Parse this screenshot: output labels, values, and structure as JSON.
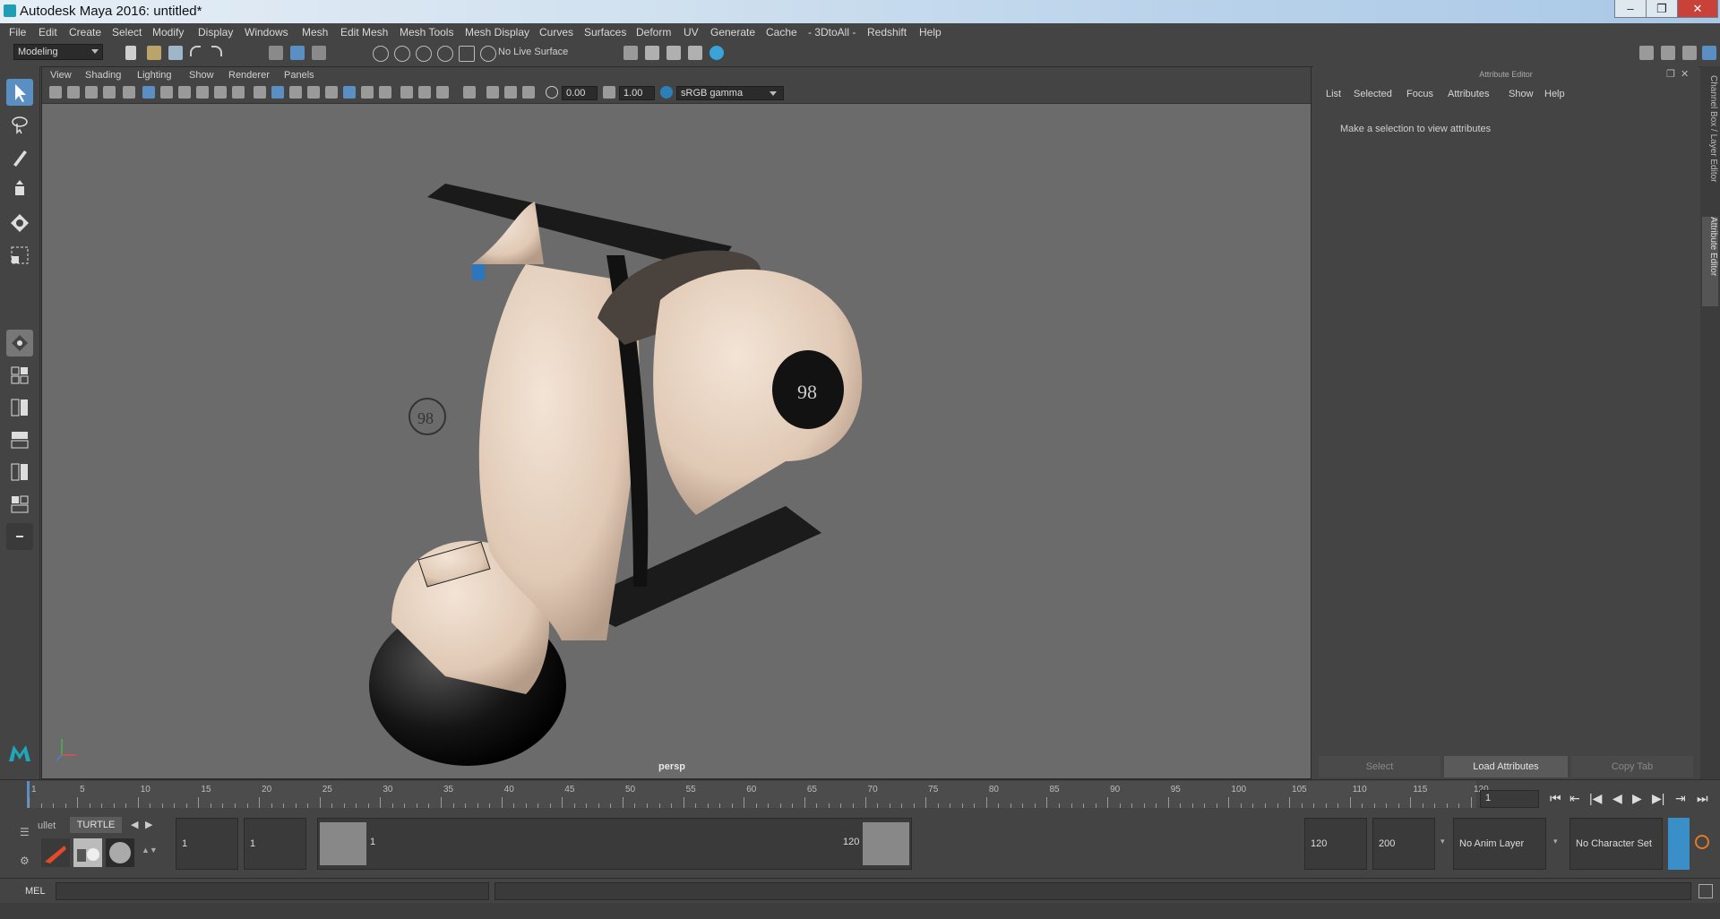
{
  "window": {
    "title": "Autodesk Maya 2016: untitled*",
    "minimize": "–",
    "maximize": "❐",
    "close": "✕"
  },
  "menubar": [
    "File",
    "Edit",
    "Create",
    "Select",
    "Modify",
    "Display",
    "Windows",
    "Mesh",
    "Edit Mesh",
    "Mesh Tools",
    "Mesh Display",
    "Curves",
    "Surfaces",
    "Deform",
    "UV",
    "Generate",
    "Cache",
    "- 3DtoAll -",
    "Redshift",
    "Help"
  ],
  "status_line": {
    "menu_set": "Modeling",
    "live_surface": "No Live Surface"
  },
  "viewport": {
    "menus": [
      "View",
      "Shading",
      "Lighting",
      "Show",
      "Renderer",
      "Panels"
    ],
    "exposure": "0.00",
    "gamma": "1.00",
    "color_space": "sRGB gamma",
    "camera_label": "persp",
    "model_badge_number": "98"
  },
  "attribute_editor": {
    "header": "Attribute Editor",
    "menus": [
      "List",
      "Selected",
      "Focus",
      "Attributes",
      "Show",
      "Help"
    ],
    "message": "Make a selection to view attributes",
    "buttons": {
      "select": "Select",
      "load": "Load Attributes",
      "copy_tab": "Copy Tab"
    }
  },
  "side_tabs": {
    "channel_box": "Channel Box / Layer Editor",
    "attribute_editor": "Attribute Editor"
  },
  "timeline": {
    "ticks": [
      "1",
      "5",
      "10",
      "15",
      "20",
      "25",
      "30",
      "35",
      "40",
      "45",
      "50",
      "55",
      "60",
      "65",
      "70",
      "75",
      "80",
      "85",
      "90",
      "95",
      "100",
      "105",
      "110",
      "115",
      "120"
    ],
    "current_frame": "1"
  },
  "range": {
    "shelf_tab_partial": "ullet",
    "shelf_tab_active": "TURTLE",
    "start_time": "1",
    "playback_start": "1",
    "slider_start": "1",
    "slider_end": "120",
    "playback_end": "120",
    "end_time": "200",
    "anim_layer": "No Anim Layer",
    "character_set": "No Character Set"
  },
  "command_line": {
    "language": "MEL"
  },
  "colors": {
    "accent": "#5a8fc4",
    "viewport_bg": "#6b6b6b",
    "panel_bg": "#444444",
    "scooter_body": "#e6d3c2"
  }
}
